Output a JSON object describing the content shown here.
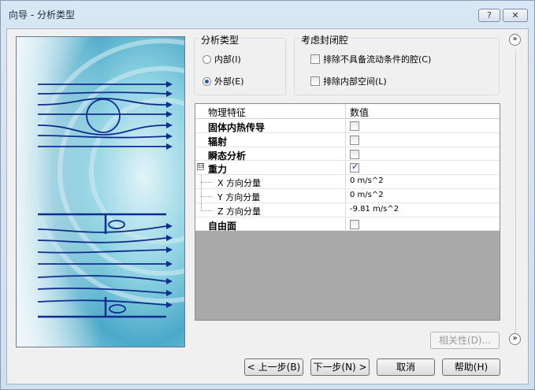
{
  "window": {
    "title": "向导 - 分析类型",
    "help_button": "?",
    "close_button": "✕"
  },
  "analysis_type": {
    "label": "分析类型",
    "options": [
      {
        "label": "内部(I)",
        "selected": false
      },
      {
        "label": "外部(E)",
        "selected": true
      }
    ]
  },
  "closed_cavity": {
    "label": "考虑封闭腔",
    "options": [
      {
        "label": "排除不具备流动条件的腔(C)",
        "checked": false
      },
      {
        "label": "排除内部空间(L)",
        "checked": false
      }
    ]
  },
  "properties": {
    "columns": [
      "物理特征",
      "数值"
    ],
    "rows": [
      {
        "name": "固体内热传导",
        "value": "",
        "checked": false,
        "type": "check"
      },
      {
        "name": "辐射",
        "value": "",
        "checked": false,
        "type": "check"
      },
      {
        "name": "瞬态分析",
        "value": "",
        "checked": false,
        "type": "check"
      },
      {
        "name": "重力",
        "value": "",
        "checked": true,
        "type": "check",
        "expander": "⊟"
      },
      {
        "name": "X 方向分量",
        "value": "0 m/s^2",
        "type": "text"
      },
      {
        "name": "Y 方向分量",
        "value": "0 m/s^2",
        "type": "text"
      },
      {
        "name": "Z 方向分量",
        "value": "-9.81 m/s^2",
        "type": "text"
      },
      {
        "name": "自由面",
        "value": "",
        "checked": false,
        "type": "check"
      }
    ]
  },
  "buttons": {
    "dependency": "相关性(D)...",
    "back": "< 上一步(B)",
    "next": "下一步(N) >",
    "cancel": "取消",
    "help": "帮助(H)"
  },
  "icons": {
    "collapse_top": "»",
    "collapse_bottom": "»"
  }
}
